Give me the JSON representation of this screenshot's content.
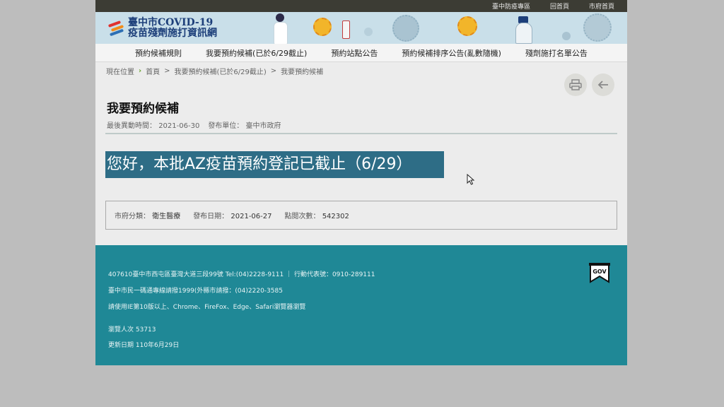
{
  "topbar": {
    "links": [
      "臺中防疫專區",
      "回首頁",
      "市府首頁"
    ]
  },
  "banner": {
    "title_line1": "臺中市COVID-19",
    "title_line2": "疫苗殘劑施打資訊網"
  },
  "nav": {
    "items": [
      "預約候補規則",
      "我要預約候補(已於6/29截止)",
      "預約站點公告",
      "預約候補排序公告(亂數隨機)",
      "殘劑施打名單公告"
    ]
  },
  "breadcrumb": {
    "label": "現在位置",
    "items": [
      "首頁",
      "我要預約候補(已於6/29截止)",
      "我要預約候補"
    ],
    "sep": ">"
  },
  "page": {
    "title": "我要預約候補",
    "updated_label": "最後異動時間：",
    "updated_value": "2021-06-30",
    "unit_label": "發布單位：",
    "unit_value": "臺中市政府"
  },
  "announcement": "您好，本批AZ疫苗預約登記已截止（6/29）",
  "info": {
    "category_label": "市府分類：",
    "category_value": "衛生醫療",
    "date_label": "發布日期：",
    "date_value": "2021-06-27",
    "views_label": "點閱次數：",
    "views_value": "542302"
  },
  "footer": {
    "address": "407610臺中市西屯區臺灣大道三段99號 Tel:(04)2228-9111 ｜ 行動代表號：0910-289111",
    "hotline": "臺中市民一碼通專線請撥1999(外縣市請撥：(04)2220-3585",
    "browser": "請使用IE第10版以上、Chrome、FireFox、Edge、Safari瀏覽器瀏覽",
    "visitors": "瀏覽人次 53713",
    "updated": "更新日期 110年6月29日",
    "gov_badge": "GOV"
  },
  "colors": {
    "accent": "#2e6d86",
    "footer": "#1f8896",
    "topbar": "#3c3c34"
  }
}
